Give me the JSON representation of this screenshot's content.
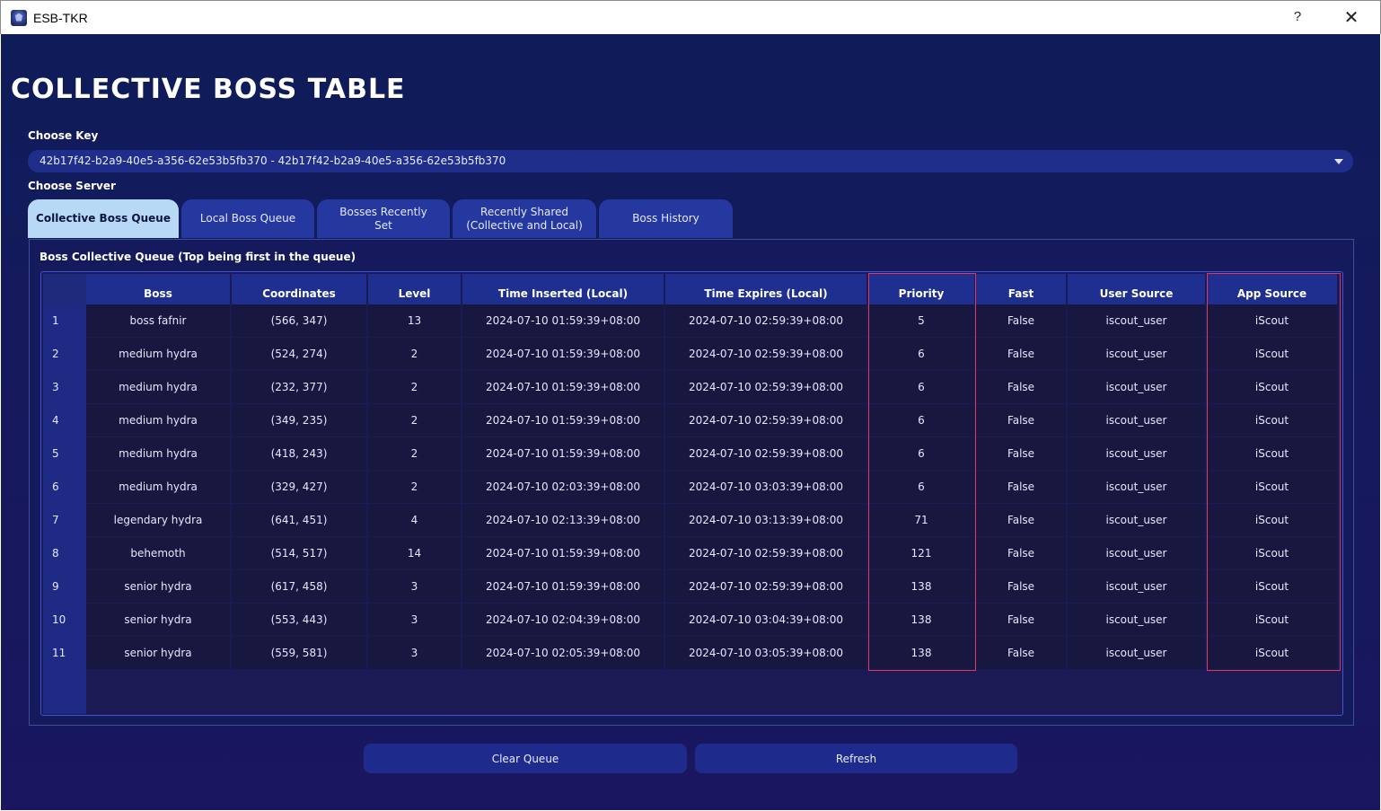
{
  "window": {
    "title": "ESB-TKR",
    "help_label": "?",
    "close_label": "✕"
  },
  "page": {
    "heading": "COLLECTIVE BOSS TABLE"
  },
  "key_select": {
    "label": "Choose Key",
    "value": "42b17f42-b2a9-40e5-a356-62e53b5fb370 - 42b17f42-b2a9-40e5-a356-62e53b5fb370"
  },
  "server": {
    "label": "Choose Server"
  },
  "tabs": [
    {
      "label": "Collective Boss Queue",
      "active": true
    },
    {
      "label": "Local Boss Queue",
      "active": false
    },
    {
      "label": "Bosses Recently\nSet",
      "active": false
    },
    {
      "label": "Recently Shared\n(Collective and Local)",
      "active": false
    },
    {
      "label": "Boss History",
      "active": false
    }
  ],
  "panel": {
    "label": "Boss Collective Queue (Top being first in the queue)"
  },
  "table": {
    "columns": [
      "Boss",
      "Coordinates",
      "Level",
      "Time Inserted (Local)",
      "Time Expires (Local)",
      "Priority",
      "Fast",
      "User Source",
      "App Source"
    ],
    "rows": [
      [
        "1",
        "boss fafnir",
        "(566, 347)",
        "13",
        "2024-07-10 01:59:39+08:00",
        "2024-07-10 02:59:39+08:00",
        "5",
        "False",
        "iscout_user",
        "iScout"
      ],
      [
        "2",
        "medium hydra",
        "(524, 274)",
        "2",
        "2024-07-10 01:59:39+08:00",
        "2024-07-10 02:59:39+08:00",
        "6",
        "False",
        "iscout_user",
        "iScout"
      ],
      [
        "3",
        "medium hydra",
        "(232, 377)",
        "2",
        "2024-07-10 01:59:39+08:00",
        "2024-07-10 02:59:39+08:00",
        "6",
        "False",
        "iscout_user",
        "iScout"
      ],
      [
        "4",
        "medium hydra",
        "(349, 235)",
        "2",
        "2024-07-10 01:59:39+08:00",
        "2024-07-10 02:59:39+08:00",
        "6",
        "False",
        "iscout_user",
        "iScout"
      ],
      [
        "5",
        "medium hydra",
        "(418, 243)",
        "2",
        "2024-07-10 01:59:39+08:00",
        "2024-07-10 02:59:39+08:00",
        "6",
        "False",
        "iscout_user",
        "iScout"
      ],
      [
        "6",
        "medium hydra",
        "(329, 427)",
        "2",
        "2024-07-10 02:03:39+08:00",
        "2024-07-10 03:03:39+08:00",
        "6",
        "False",
        "iscout_user",
        "iScout"
      ],
      [
        "7",
        "legendary hydra",
        "(641, 451)",
        "4",
        "2024-07-10 02:13:39+08:00",
        "2024-07-10 03:13:39+08:00",
        "71",
        "False",
        "iscout_user",
        "iScout"
      ],
      [
        "8",
        "behemoth",
        "(514, 517)",
        "14",
        "2024-07-10 01:59:39+08:00",
        "2024-07-10 02:59:39+08:00",
        "121",
        "False",
        "iscout_user",
        "iScout"
      ],
      [
        "9",
        "senior hydra",
        "(617, 458)",
        "3",
        "2024-07-10 01:59:39+08:00",
        "2024-07-10 02:59:39+08:00",
        "138",
        "False",
        "iscout_user",
        "iScout"
      ],
      [
        "10",
        "senior hydra",
        "(553, 443)",
        "3",
        "2024-07-10 02:04:39+08:00",
        "2024-07-10 03:04:39+08:00",
        "138",
        "False",
        "iscout_user",
        "iScout"
      ],
      [
        "11",
        "senior hydra",
        "(559, 581)",
        "3",
        "2024-07-10 02:05:39+08:00",
        "2024-07-10 03:05:39+08:00",
        "138",
        "False",
        "iscout_user",
        "iScout"
      ]
    ]
  },
  "buttons": {
    "clear": "Clear Queue",
    "refresh": "Refresh"
  },
  "colors": {
    "background": "#151a5c",
    "tab_active": "#b8d9f6",
    "tab_inactive": "#2538a0",
    "highlight": "#e0395a"
  }
}
